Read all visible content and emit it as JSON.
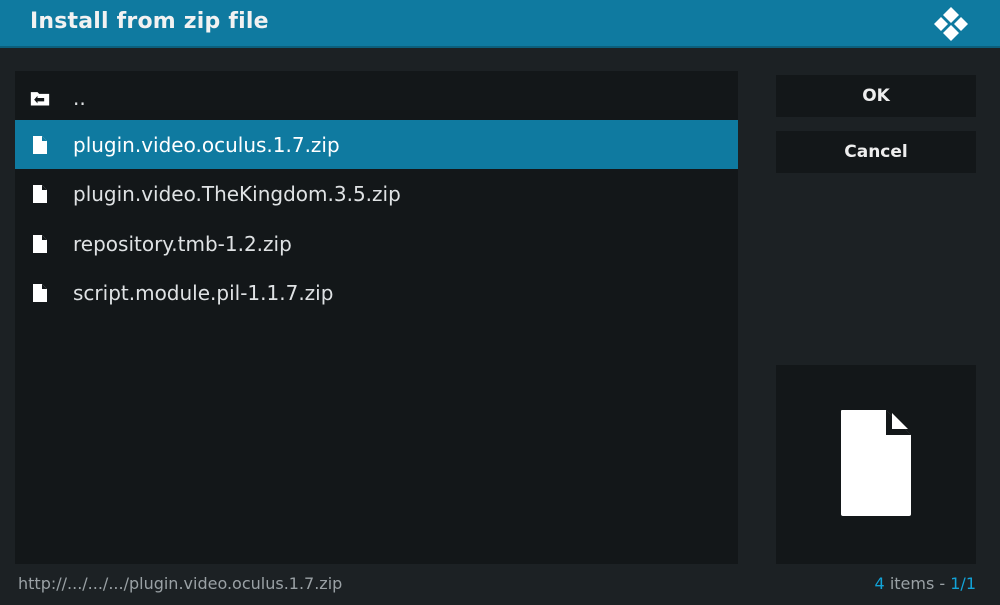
{
  "header": {
    "title": "Install from zip file",
    "logo_icon": "kodi-logo-icon",
    "accent_color": "#0f7aa0"
  },
  "file_list": {
    "items": [
      {
        "label": "..",
        "icon": "folder-back-icon",
        "selected": false
      },
      {
        "label": "plugin.video.oculus.1.7.zip",
        "icon": "file-icon",
        "selected": true
      },
      {
        "label": "plugin.video.TheKingdom.3.5.zip",
        "icon": "file-icon",
        "selected": false
      },
      {
        "label": "repository.tmb-1.2.zip",
        "icon": "file-icon",
        "selected": false
      },
      {
        "label": "script.module.pil-1.1.7.zip",
        "icon": "file-icon",
        "selected": false
      }
    ]
  },
  "buttons": {
    "ok_label": "OK",
    "cancel_label": "Cancel"
  },
  "preview": {
    "icon": "file-icon"
  },
  "footer": {
    "path": "http://.../.../.../plugin.video.oculus.1.7.zip",
    "item_count": "4",
    "items_word": " items - ",
    "page": "1/1"
  }
}
